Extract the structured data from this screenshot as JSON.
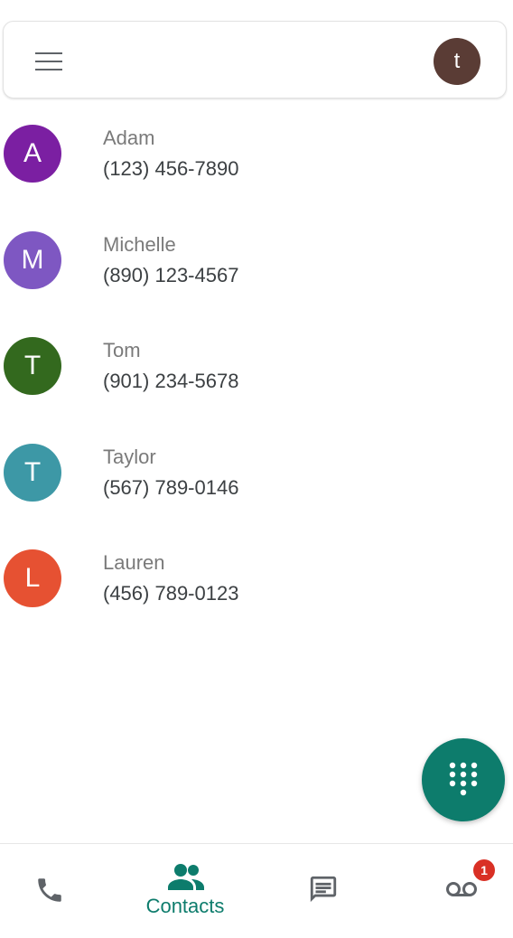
{
  "header": {
    "menu_icon": "hamburger-menu-icon",
    "account_initial": "t",
    "account_color": "#5a3c35"
  },
  "contacts": [
    {
      "initial": "A",
      "name": "Adam",
      "phone": "(123) 456-7890",
      "color": "#7b1fa2"
    },
    {
      "initial": "M",
      "name": "Michelle",
      "phone": "(890) 123-4567",
      "color": "#7e57c2"
    },
    {
      "initial": "T",
      "name": "Tom",
      "phone": "(901) 234-5678",
      "color": "#33691e"
    },
    {
      "initial": "T",
      "name": "Taylor",
      "phone": "(567) 789-0146",
      "color": "#3d98a6"
    },
    {
      "initial": "L",
      "name": "Lauren",
      "phone": "(456) 789-0123",
      "color": "#e65132"
    }
  ],
  "fab": {
    "icon": "dialpad-icon",
    "color": "#0d7c6c"
  },
  "bottom_nav": {
    "calls_icon": "phone-icon",
    "contacts_icon": "people-icon",
    "contacts_label": "Contacts",
    "messages_icon": "message-icon",
    "voicemail_icon": "voicemail-icon",
    "voicemail_badge": "1",
    "active_color": "#0d7c6c",
    "badge_color": "#d93025"
  }
}
